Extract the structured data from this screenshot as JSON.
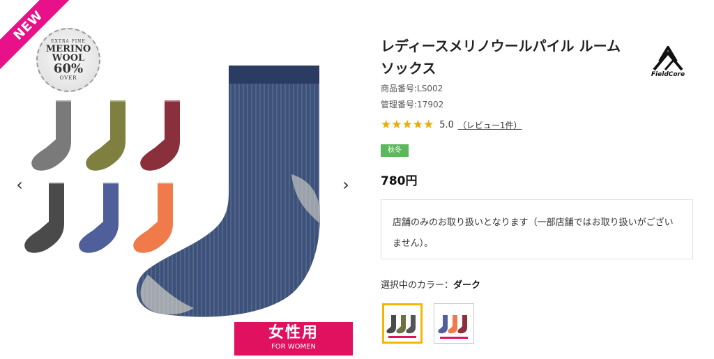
{
  "product": {
    "title": "レディースメリノウールパイル ルームソックス",
    "item_number": "商品番号:LS002",
    "management_number": "管理番号:17902",
    "stars": "★★★★★",
    "rating": "5.0",
    "review_link": "（レビュー1件）",
    "season_tag": "秋冬",
    "price": "780円",
    "notice": "店舗のみのお取り扱いとなります（一部店舗ではお取り扱いがございません）。",
    "color_label_prefix": "選択中のカラー：",
    "color_label_value": "ダーク"
  },
  "brand": {
    "name": "FieldCore"
  },
  "gallery": {
    "new_badge": "NEW",
    "seal": {
      "top": "EXTRA FINE",
      "line1": "MERINO",
      "line2": "WOOL",
      "percent": "60%",
      "bottom": "OVER"
    },
    "women_badge_big": "女性用",
    "women_badge_small": "FOR WOMEN",
    "prev_arrow": "‹",
    "next_arrow": "›",
    "thumb_colors": [
      "#7a7a7a",
      "#7f8040",
      "#8a2f3c",
      "#4a4a4a",
      "#4e5f99",
      "#f07a4a"
    ],
    "main_sock_color": "#3d527a"
  },
  "swatches": [
    {
      "colors": [
        "#4a4a4a",
        "#6f7040",
        "#555555"
      ],
      "selected": true
    },
    {
      "colors": [
        "#4e5f99",
        "#f07a4a",
        "#8a2f3c"
      ],
      "selected": false
    }
  ],
  "colors": {
    "accent_pink": "#e8118a",
    "badge_red": "#e0115f",
    "star": "#f2a900",
    "tag_green": "#5cb85c",
    "selected_border": "#f5b800"
  }
}
